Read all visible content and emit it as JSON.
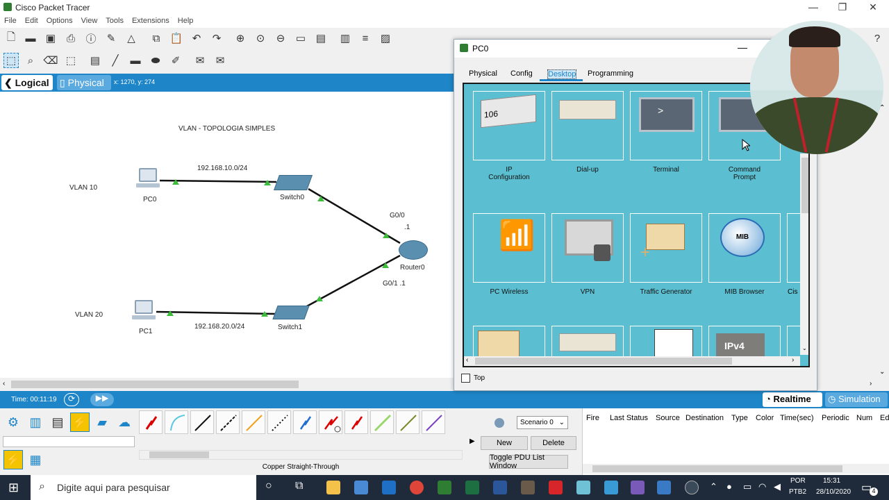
{
  "app": {
    "title": "Cisco Packet Tracer"
  },
  "menu": [
    "File",
    "Edit",
    "Options",
    "View",
    "Tools",
    "Extensions",
    "Help"
  ],
  "modes": {
    "logical": "Logical",
    "physical": "Physical",
    "coords": "x: 1270, y: 274"
  },
  "topology": {
    "title": "VLAN - TOPOLOGIA SIMPLES",
    "vlan10": "VLAN 10",
    "vlan20": "VLAN 20",
    "net10": "192.168.10.0/24",
    "net20": "192.168.20.0/24",
    "pc0": "PC0",
    "pc1": "PC1",
    "switch0": "Switch0",
    "switch1": "Switch1",
    "router0": "Router0",
    "g00": "G0/0",
    "g00_ip": ".1",
    "g01": "G0/1  .1"
  },
  "timebar": {
    "time": "Time: 00:11:19",
    "realtime": "Realtime",
    "simulation": "Simulation"
  },
  "bottom": {
    "connection_type": "Copper Straight-Through",
    "scenario": "Scenario 0",
    "new": "New",
    "delete": "Delete",
    "toggle": "Toggle PDU List Window",
    "pdu_headers": [
      "Fire",
      "Last Status",
      "Source",
      "Destination",
      "Type",
      "Color",
      "Time(sec)",
      "Periodic",
      "Num",
      "Ed"
    ]
  },
  "pc_window": {
    "title": "PC0",
    "tabs": [
      "Physical",
      "Config",
      "Desktop",
      "Programming"
    ],
    "apps_row1": [
      "IP\nConfiguration",
      "Dial-up",
      "Terminal",
      "Command\nPrompt"
    ],
    "apps_row2": [
      "PC Wireless",
      "VPN",
      "Traffic Generator",
      "MIB Browser",
      "Cis"
    ],
    "ip_icon_text": "106",
    "terminal_icon_text": ">",
    "mib_icon_text": "MIB",
    "ipv4_icon_text": "IPv4",
    "top_checkbox": "Top"
  },
  "taskbar": {
    "search_placeholder": "Digite aqui para pesquisar",
    "lang": "POR",
    "lang2": "PTB2",
    "time": "15:31",
    "date": "28/10/2020",
    "notif_count": "4"
  }
}
